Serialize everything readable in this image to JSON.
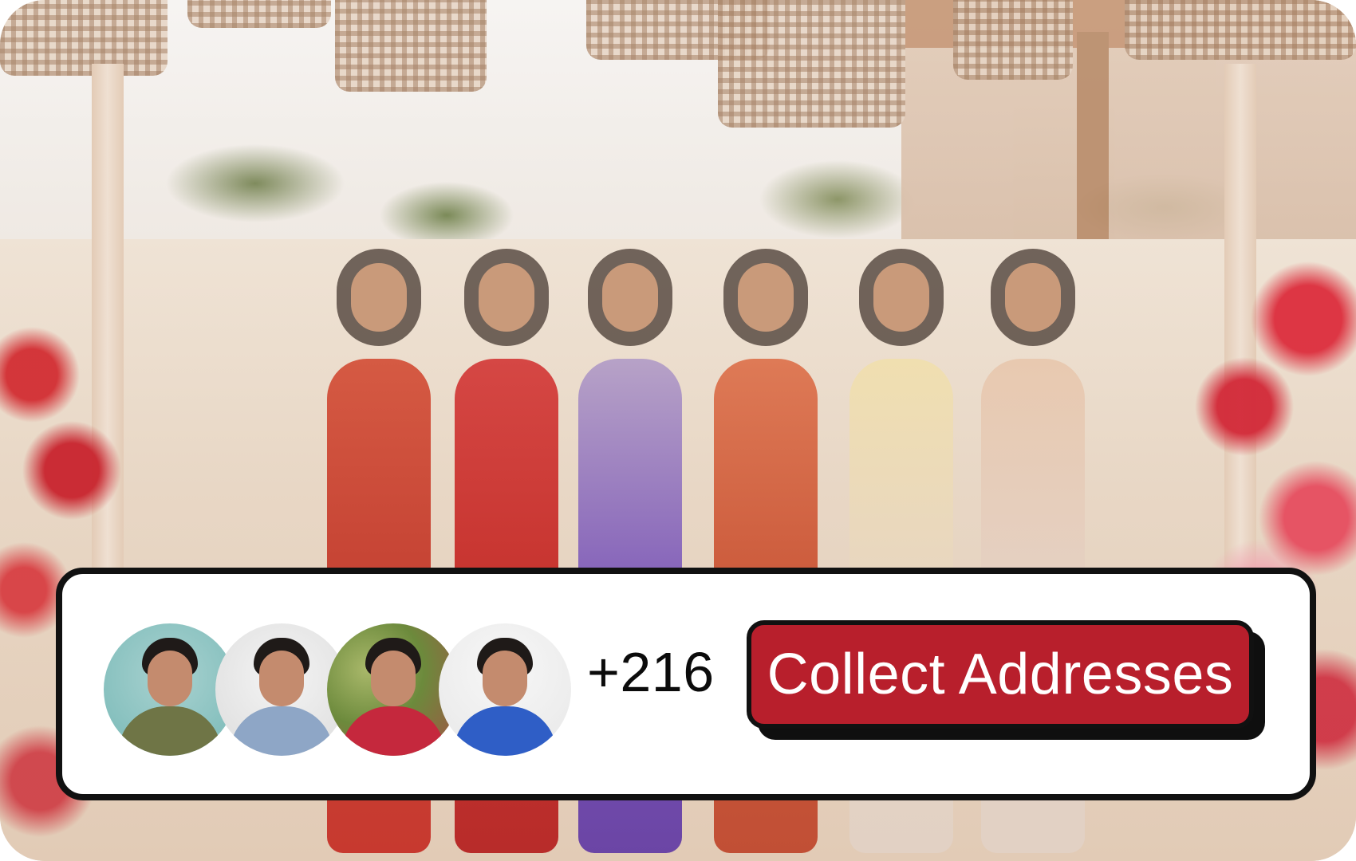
{
  "scene": {
    "accent_red": "#b81f2c"
  },
  "social_proof": {
    "avatars": [
      {
        "name": "person-avatar-1"
      },
      {
        "name": "person-avatar-2"
      },
      {
        "name": "person-avatar-3"
      },
      {
        "name": "person-avatar-4"
      }
    ],
    "count_text": "+216"
  },
  "cta": {
    "label": "Collect Addresses"
  }
}
